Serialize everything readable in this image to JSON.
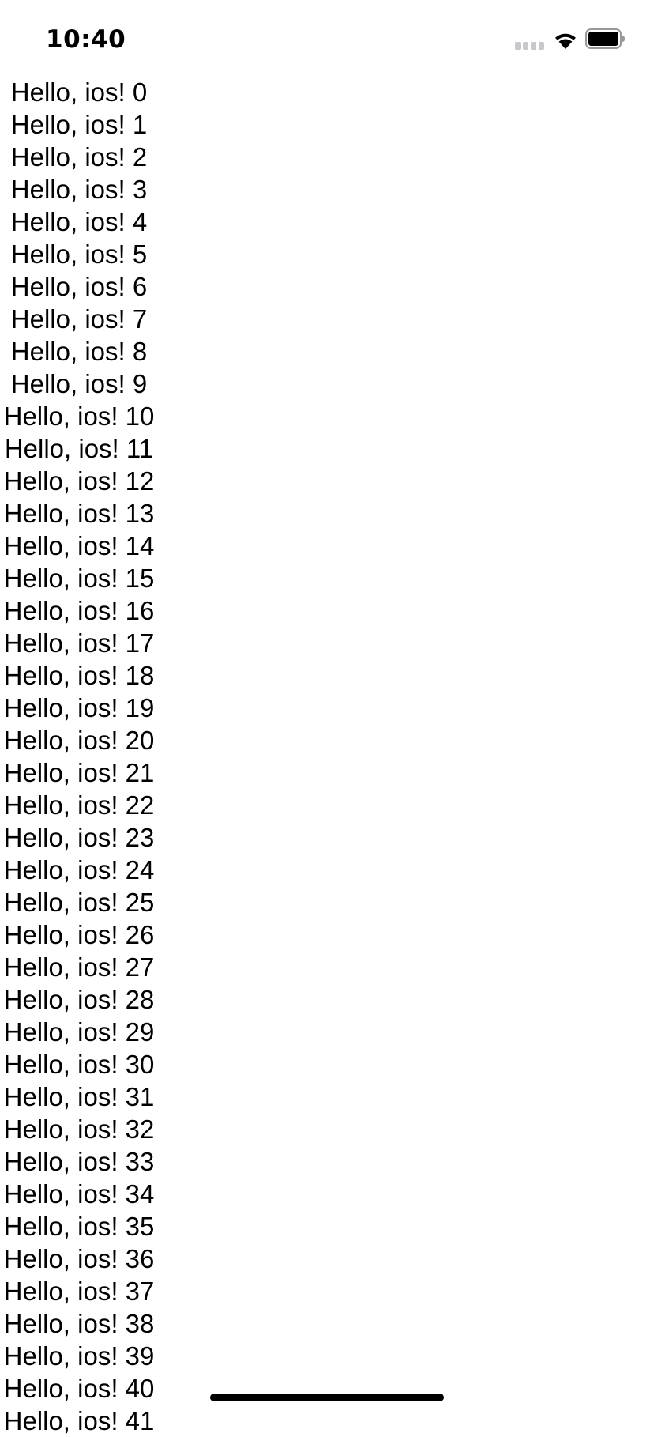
{
  "status_bar": {
    "time": "10:40",
    "icons": [
      "cellular-signal-icon",
      "wifi-icon",
      "battery-icon"
    ]
  },
  "list": {
    "items": [
      "Hello, ios! 0",
      "Hello, ios! 1",
      "Hello, ios! 2",
      "Hello, ios! 3",
      "Hello, ios! 4",
      "Hello, ios! 5",
      "Hello, ios! 6",
      "Hello, ios! 7",
      "Hello, ios! 8",
      "Hello, ios! 9",
      "Hello, ios! 10",
      "Hello, ios! 11",
      "Hello, ios! 12",
      "Hello, ios! 13",
      "Hello, ios! 14",
      "Hello, ios! 15",
      "Hello, ios! 16",
      "Hello, ios! 17",
      "Hello, ios! 18",
      "Hello, ios! 19",
      "Hello, ios! 20",
      "Hello, ios! 21",
      "Hello, ios! 22",
      "Hello, ios! 23",
      "Hello, ios! 24",
      "Hello, ios! 25",
      "Hello, ios! 26",
      "Hello, ios! 27",
      "Hello, ios! 28",
      "Hello, ios! 29",
      "Hello, ios! 30",
      "Hello, ios! 31",
      "Hello, ios! 32",
      "Hello, ios! 33",
      "Hello, ios! 34",
      "Hello, ios! 35",
      "Hello, ios! 36",
      "Hello, ios! 37",
      "Hello, ios! 38",
      "Hello, ios! 39",
      "Hello, ios! 40",
      "Hello, ios! 41"
    ]
  },
  "colors": {
    "background": "#ffffff",
    "text": "#000000",
    "signal_inactive": "#c7c7cc"
  }
}
